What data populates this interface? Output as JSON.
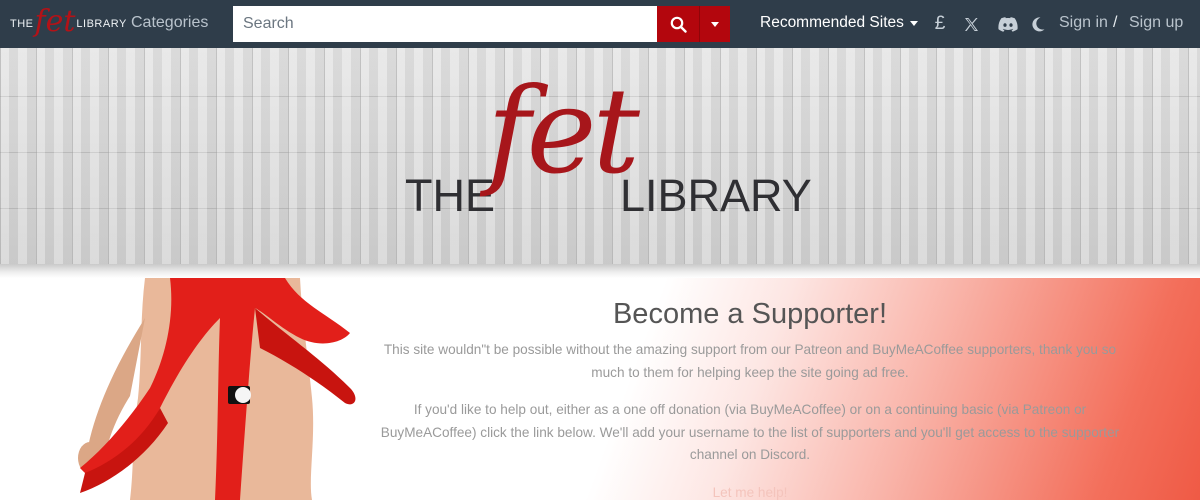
{
  "navbar": {
    "logo": {
      "the": "THE",
      "fet": "fet",
      "library": "LIBRARY"
    },
    "categories_label": "Categories",
    "search": {
      "placeholder": "Search",
      "value": ""
    },
    "recommended_label": "Recommended Sites",
    "pound_symbol": "£",
    "sign_in_label": "Sign in",
    "separator": "/",
    "sign_up_label": "Sign up"
  },
  "banner": {
    "logo": {
      "the": "THE",
      "fet": "fet",
      "library": "LIBRARY"
    }
  },
  "support": {
    "title": "Become a Supporter!",
    "paragraph1": "This site wouldn\"t be possible without the amazing support from our Patreon and BuyMeACoffee supporters, thank you so much to them for helping keep the site going ad free.",
    "paragraph2": "If you'd like to help out, either as a one off donation (via BuyMeACoffee) or on a continuing basic (via Patreon or BuyMeACoffee) click the link below. We'll add your username to the list of supporters and you'll get access to the supporter channel on Discord.",
    "link_label": "Let me help!"
  },
  "colors": {
    "navbar_bg": "#2f3d4a",
    "brand_red": "#b3060d",
    "logo_red": "#a7161b"
  },
  "icons": [
    "search-icon",
    "caret-down-icon",
    "pound-icon",
    "x-twitter-icon",
    "discord-icon",
    "moon-icon"
  ]
}
